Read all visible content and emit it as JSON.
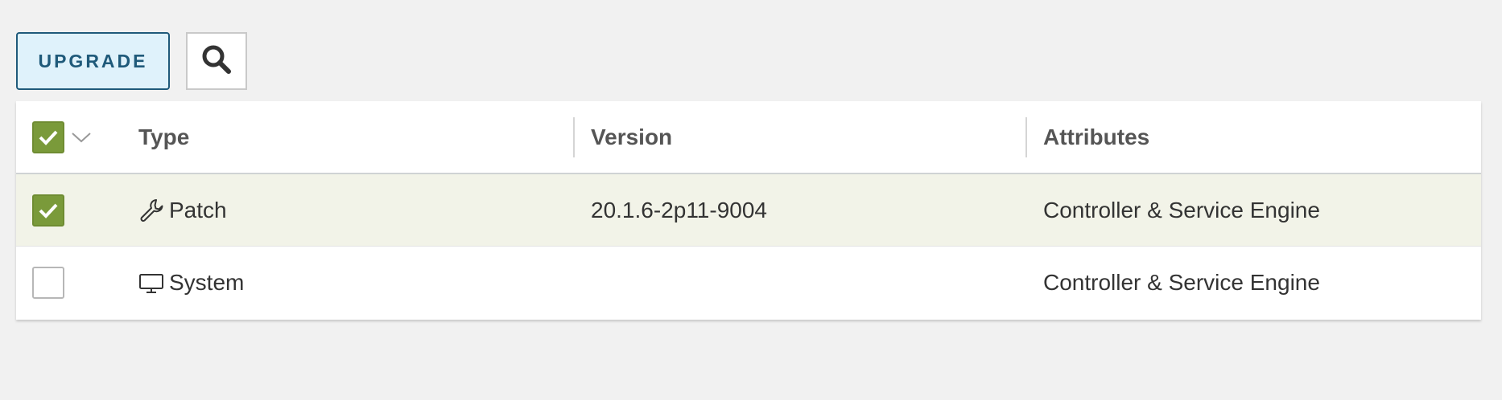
{
  "toolbar": {
    "upgrade_label": "UPGRADE",
    "search_icon": "search-icon"
  },
  "table": {
    "columns": [
      "Type",
      "Version",
      "Attributes"
    ],
    "select_all_checked": true,
    "rows": [
      {
        "checked": true,
        "icon": "wrench-icon",
        "type": "Patch",
        "version": "20.1.6-2p11-9004",
        "attributes": "Controller & Service Engine"
      },
      {
        "checked": false,
        "icon": "monitor-icon",
        "type": "System",
        "version": "",
        "attributes": "Controller & Service Engine"
      }
    ]
  },
  "colors": {
    "accent": "#1f5a7a",
    "checkbox_on": "#7a9a3a",
    "selected_row": "#f2f3e8"
  }
}
